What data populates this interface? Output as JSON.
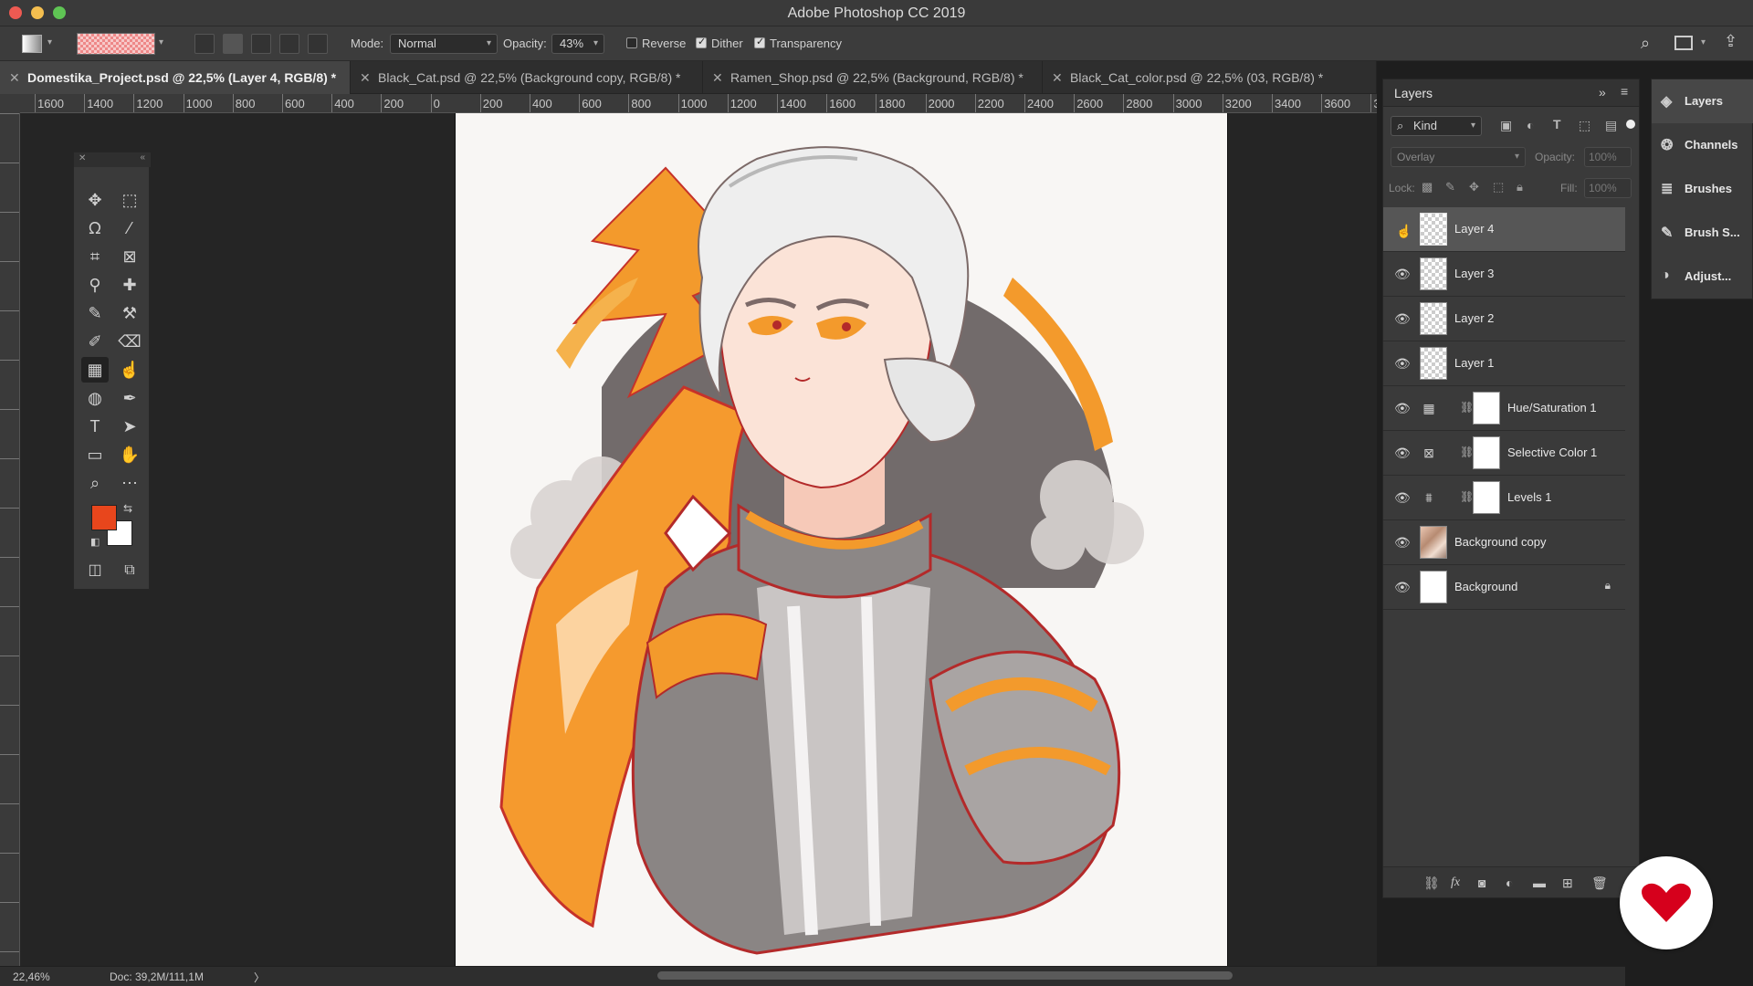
{
  "app": {
    "title": "Adobe Photoshop CC 2019"
  },
  "options_bar": {
    "mode_label": "Mode:",
    "mode_value": "Normal",
    "opacity_label": "Opacity:",
    "opacity_value": "43%",
    "reverse_label": "Reverse",
    "reverse_checked": false,
    "dither_label": "Dither",
    "dither_checked": true,
    "transparency_label": "Transparency",
    "transparency_checked": true
  },
  "tabs": [
    {
      "label": "Domestika_Project.psd @ 22,5% (Layer 4, RGB/8) *",
      "active": true
    },
    {
      "label": "Black_Cat.psd @ 22,5% (Background copy, RGB/8) *",
      "active": false
    },
    {
      "label": "Ramen_Shop.psd @ 22,5% (Background, RGB/8) *",
      "active": false
    },
    {
      "label": "Black_Cat_color.psd @ 22,5% (03, RGB/8) *",
      "active": false
    }
  ],
  "ruler": {
    "h_ticks": [
      "1600",
      "1400",
      "1200",
      "1000",
      "800",
      "600",
      "400",
      "200",
      "0",
      "200",
      "400",
      "600",
      "800",
      "1000",
      "1200",
      "1400",
      "1600",
      "1800",
      "2000",
      "2200",
      "2400",
      "2600",
      "2800",
      "3000",
      "3200",
      "3400",
      "3600",
      "3"
    ]
  },
  "status": {
    "zoom": "22,46%",
    "doc": "Doc: 39,2M/111,1M",
    "arrow": "〉"
  },
  "layers_panel": {
    "title": "Layers",
    "filter_kind": "Kind",
    "blend_mode": "Overlay",
    "opacity_label": "Opacity:",
    "opacity_value": "100%",
    "lock_label": "Lock:",
    "fill_label": "Fill:",
    "fill_value": "100%",
    "layers": [
      {
        "name": "Layer 4",
        "thumb": "transparent",
        "selected": true,
        "visible": false
      },
      {
        "name": "Layer 3",
        "thumb": "transparent",
        "selected": false,
        "visible": true
      },
      {
        "name": "Layer 2",
        "thumb": "transparent",
        "selected": false,
        "visible": true
      },
      {
        "name": "Layer 1",
        "thumb": "transparent",
        "selected": false,
        "visible": true
      },
      {
        "name": "Hue/Saturation 1",
        "thumb": "adjustment",
        "adj_icon": "hue-saturation-icon",
        "selected": false,
        "visible": true
      },
      {
        "name": "Selective Color 1",
        "thumb": "adjustment",
        "adj_icon": "selective-color-icon",
        "selected": false,
        "visible": true
      },
      {
        "name": "Levels 1",
        "thumb": "adjustment",
        "adj_icon": "levels-icon",
        "selected": false,
        "visible": true
      },
      {
        "name": "Background copy",
        "thumb": "art",
        "selected": false,
        "visible": true
      },
      {
        "name": "Background",
        "thumb": "white",
        "selected": false,
        "visible": true,
        "locked": true
      }
    ]
  },
  "dock": [
    {
      "label": "Layers",
      "icon": "layers-icon"
    },
    {
      "label": "Channels",
      "icon": "channels-icon"
    },
    {
      "label": "Brushes",
      "icon": "brushes-icon"
    },
    {
      "label": "Brush S...",
      "icon": "brush-settings-icon"
    },
    {
      "label": "Adjust...",
      "icon": "adjustments-icon"
    }
  ],
  "colors": {
    "foreground": "#e8461c",
    "background": "#ffffff",
    "accent_orange": "#f39a2c",
    "logo_red": "#d6001c"
  }
}
